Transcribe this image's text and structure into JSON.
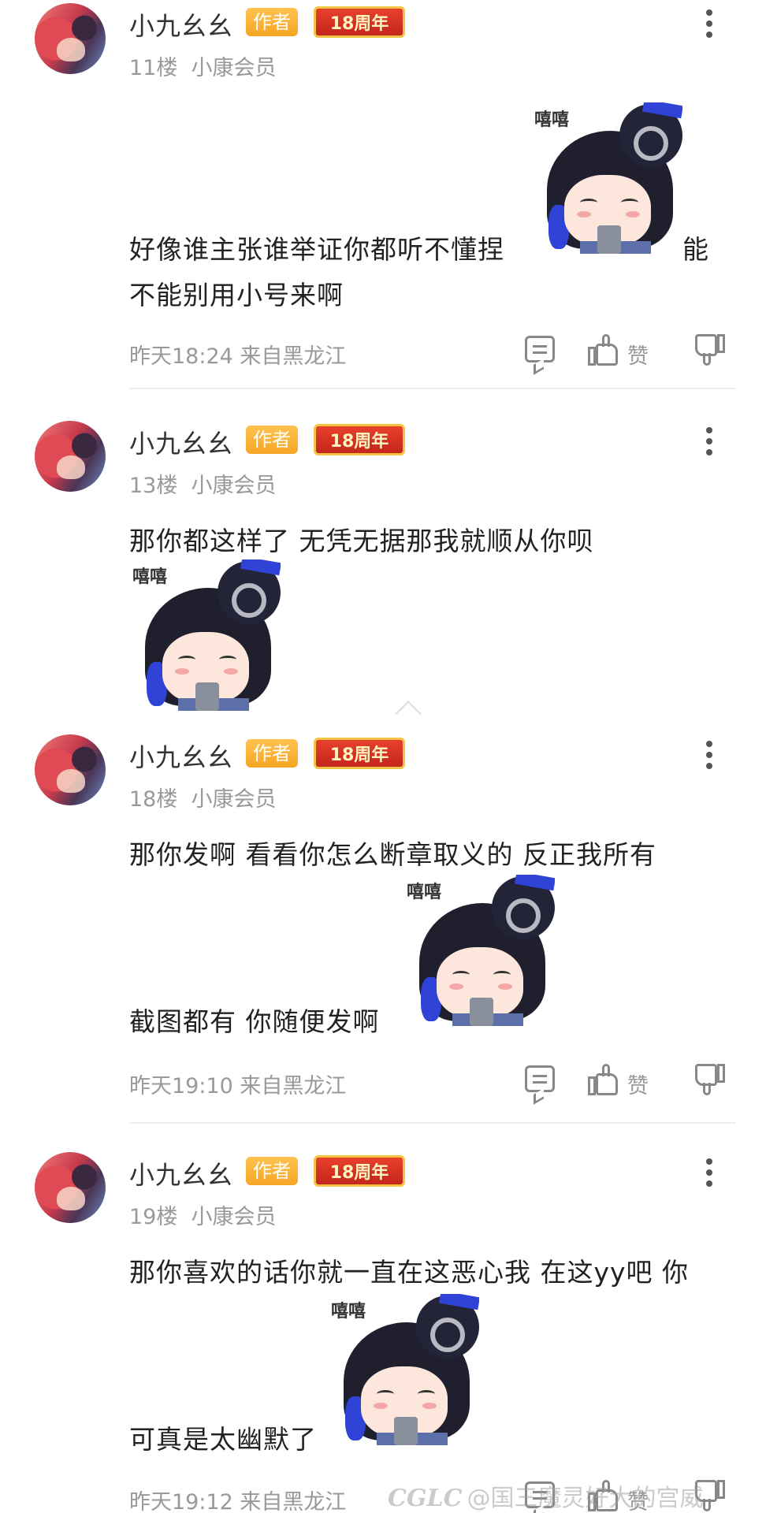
{
  "posts": [
    {
      "username": "小九幺幺",
      "author_badge": "作者",
      "anniversary_badge": "18周年",
      "floor": "11楼",
      "member": "小康会员",
      "text_lines": [
        "好像谁主张谁举证你都听不懂捏",
        "能",
        "不能别用小号来啊"
      ],
      "sticker_label": "嘻嘻",
      "timestamp": "昨天18:24 来自黑龙江",
      "like_label": "赞"
    },
    {
      "username": "小九幺幺",
      "author_badge": "作者",
      "anniversary_badge": "18周年",
      "floor": "13楼",
      "member": "小康会员",
      "text_lines": [
        "那你都这样了  无凭无据那我就顺从你呗"
      ],
      "sticker_label": "嘻嘻"
    },
    {
      "username": "小九幺幺",
      "author_badge": "作者",
      "anniversary_badge": "18周年",
      "floor": "18楼",
      "member": "小康会员",
      "text_lines": [
        "那你发啊   看看你怎么断章取义的  反正我所有",
        "截图都有  你随便发啊"
      ],
      "sticker_label": "嘻嘻",
      "timestamp": "昨天19:10 来自黑龙江",
      "like_label": "赞"
    },
    {
      "username": "小九幺幺",
      "author_badge": "作者",
      "anniversary_badge": "18周年",
      "floor": "19楼",
      "member": "小康会员",
      "text_lines": [
        "那你喜欢的话你就一直在这恶心我 在这yy吧  你",
        "可真是太幽默了"
      ],
      "sticker_label": "嘻嘻",
      "timestamp": "昨天19:12 来自黑龙江",
      "like_label": "赞"
    }
  ],
  "watermark": {
    "logo": "CGLC",
    "text": "@国三魔灵好大的宫威"
  },
  "icons": [
    "more-vert-icon",
    "comment-icon",
    "thumb-up-icon",
    "thumb-down-icon"
  ]
}
